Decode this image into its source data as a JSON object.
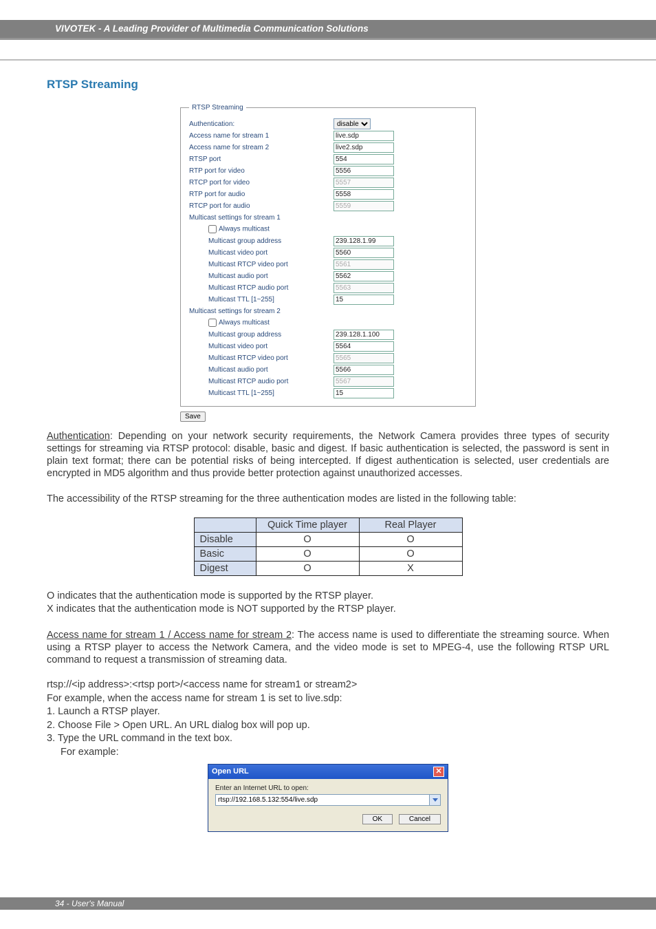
{
  "header": {
    "brand": "VIVOTEK - A Leading Provider of Multimedia Communication Solutions"
  },
  "section_title": "RTSP Streaming",
  "fieldset_legend": "RTSP Streaming",
  "form": {
    "auth_label": "Authentication:",
    "auth_value": "disable",
    "access1_label": "Access name for stream 1",
    "access1_value": "live.sdp",
    "access2_label": "Access name for stream 2",
    "access2_value": "live2.sdp",
    "rtsp_port_label": "RTSP port",
    "rtsp_port_value": "554",
    "rtp_video_label": "RTP port for video",
    "rtp_video_value": "5556",
    "rtcp_video_label": "RTCP port for video",
    "rtcp_video_value": "5557",
    "rtp_audio_label": "RTP port for audio",
    "rtp_audio_value": "5558",
    "rtcp_audio_label": "RTCP port for audio",
    "rtcp_audio_value": "5559",
    "mc1_header": "Multicast settings for stream 1",
    "always_mc": "Always multicast",
    "mc_group_label": "Multicast group address",
    "mc1_group_value": "239.128.1.99",
    "mc_video_label": "Multicast video port",
    "mc1_video_value": "5560",
    "mc_rtcp_video_label": "Multicast RTCP video port",
    "mc1_rtcp_video_value": "5561",
    "mc_audio_label": "Multicast audio port",
    "mc1_audio_value": "5562",
    "mc_rtcp_audio_label": "Multicast RTCP audio port",
    "mc1_rtcp_audio_value": "5563",
    "mc_ttl_label": "Multicast TTL [1~255]",
    "mc1_ttl_value": "15",
    "mc2_header": "Multicast settings for stream 2",
    "mc2_group_value": "239.128.1.100",
    "mc2_video_value": "5564",
    "mc2_rtcp_video_value": "5565",
    "mc2_audio_value": "5566",
    "mc2_rtcp_audio_value": "5567",
    "mc2_ttl_value": "15",
    "save_label": "Save"
  },
  "para1_lead": "Authentication",
  "para1_rest": ": Depending on your network security requirements, the Network Camera provides three types of security settings for streaming via RTSP protocol: disable, basic and digest. If basic authentication is selected, the password is sent in plain text format; there can be potential risks of being intercepted. If digest authentication is selected, user credentials are encrypted in MD5 algorithm and thus provide better protection against unauthorized accesses.",
  "para2": "The accessibility of the RTSP streaming for the three authentication modes are listed in the following table:",
  "table": {
    "col1": "Quick Time player",
    "col2": "Real Player",
    "rows": [
      {
        "h": "Disable",
        "c1": "O",
        "c2": "O"
      },
      {
        "h": "Basic",
        "c1": "O",
        "c2": "O"
      },
      {
        "h": "Digest",
        "c1": "O",
        "c2": "X"
      }
    ]
  },
  "legend_o": "O indicates that the authentication mode is supported by the RTSP player.",
  "legend_x": "X indicates that the authentication mode is NOT supported by the RTSP player.",
  "para3_lead": "Access name for stream 1 / Access name for stream 2",
  "para3_rest": ": The access name is used to differentiate the streaming source. When using a RTSP player to access the Network Camera, and the video mode is set to MPEG-4, use the following RTSP URL command to request a transmission of streaming data.",
  "url_syntax": "rtsp://<ip address>:<rtsp port>/<access name for stream1 or stream2>",
  "example_intro": "For example, when the access name for stream 1 is set to live.sdp:",
  "steps": {
    "s1": "1. Launch a RTSP player.",
    "s2": "2. Choose File > Open URL. An URL dialog box will pop up.",
    "s3": "3. Type the URL command in the text box.",
    "s3b": "For example:"
  },
  "dialog": {
    "title": "Open URL",
    "prompt": "Enter an Internet URL to open:",
    "value": "rtsp://192.168.5.132:554/live.sdp",
    "ok": "OK",
    "cancel": "Cancel"
  },
  "footer": "34 - User's Manual"
}
